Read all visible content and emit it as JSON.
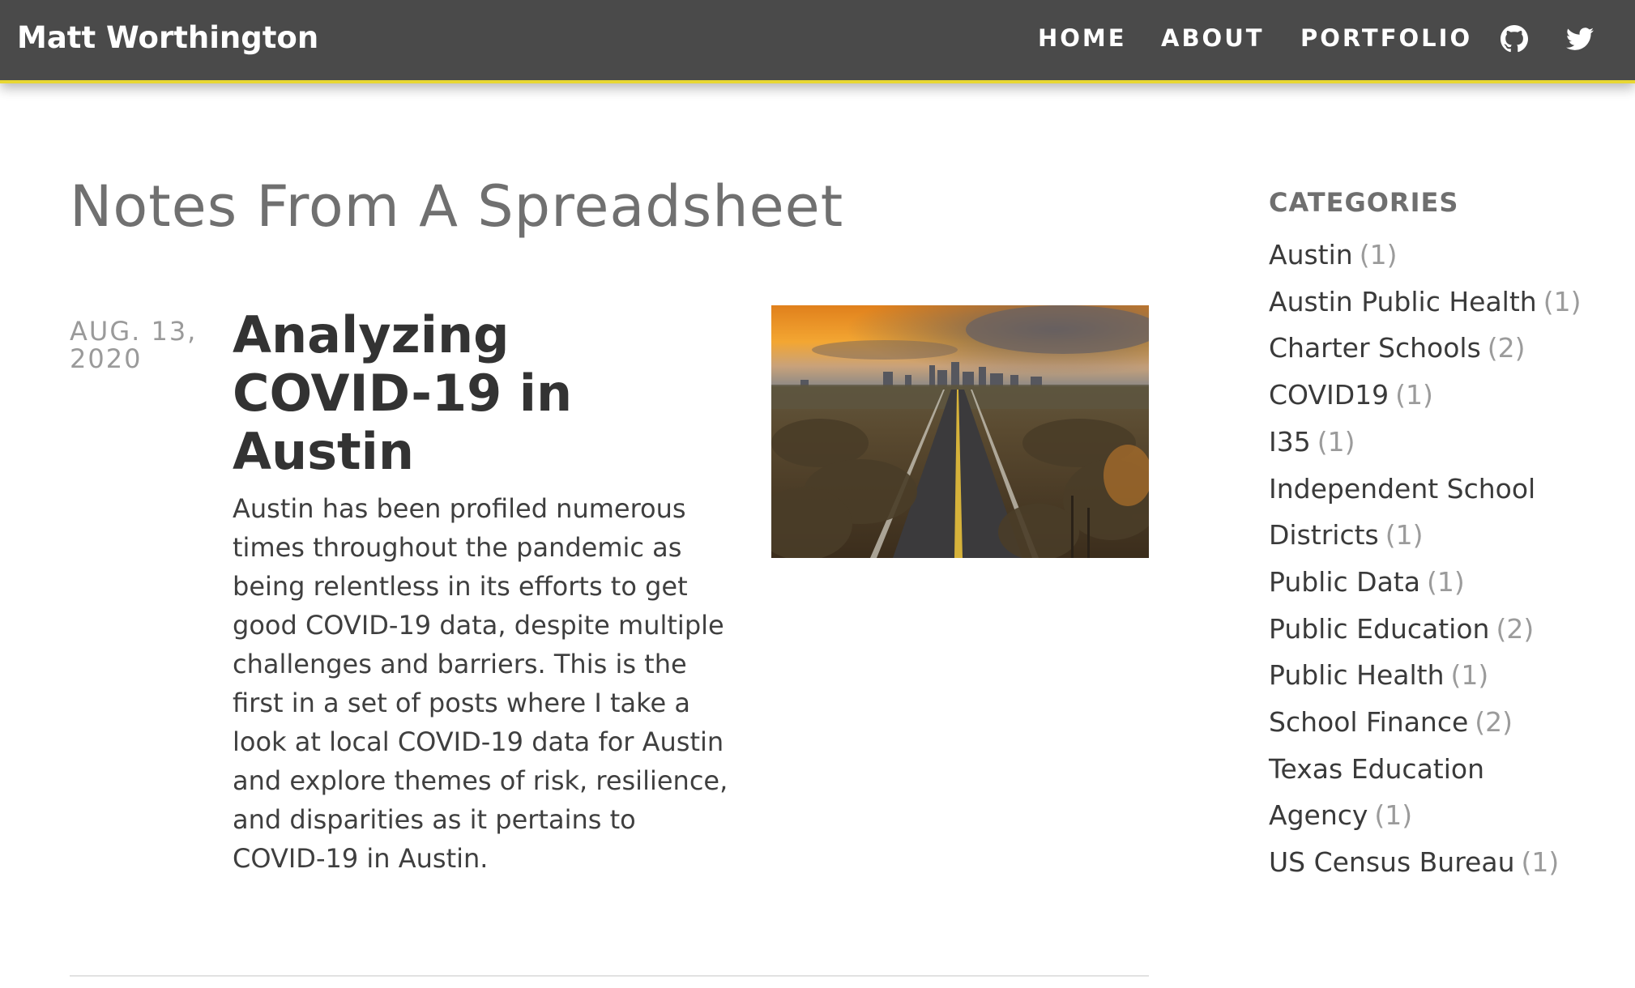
{
  "header": {
    "brand": "Matt Worthington",
    "nav": {
      "home": "HOME",
      "about": "ABOUT",
      "portfolio": "PORTFOLIO"
    },
    "icons": [
      "github-icon",
      "twitter-icon"
    ],
    "accent_color": "#e8d733",
    "background_color": "#4a4a4a"
  },
  "main": {
    "page_title": "Notes From A Spreadsheet",
    "post": {
      "date": "AUG. 13, 2020",
      "title": "Analyzing COVID-19 in Austin",
      "excerpt": "Austin has been profiled numerous times throughout the pandemic as being relentless in its efforts to get good COVID-19 data, despite multiple challenges and barriers. This is the first in a set of posts where I take a look at local COVID-19 data for Austin and explore themes of risk, resilience, and disparities as it pertains to COVID-19 in Austin."
    }
  },
  "sidebar": {
    "heading": "CATEGORIES",
    "categories": [
      {
        "name": "Austin",
        "count": "(1)"
      },
      {
        "name": "Austin Public Health",
        "count": "(1)"
      },
      {
        "name": "Charter Schools",
        "count": "(2)"
      },
      {
        "name": "COVID19",
        "count": "(1)"
      },
      {
        "name": "I35",
        "count": "(1)"
      },
      {
        "name": "Independent School Districts",
        "count": "(1)"
      },
      {
        "name": "Public Data",
        "count": "(1)"
      },
      {
        "name": "Public Education",
        "count": "(2)"
      },
      {
        "name": "Public Health",
        "count": "(1)"
      },
      {
        "name": "School Finance",
        "count": "(2)"
      },
      {
        "name": "Texas Education Agency",
        "count": "(1)"
      },
      {
        "name": "US Census Bureau",
        "count": "(1)"
      }
    ]
  }
}
